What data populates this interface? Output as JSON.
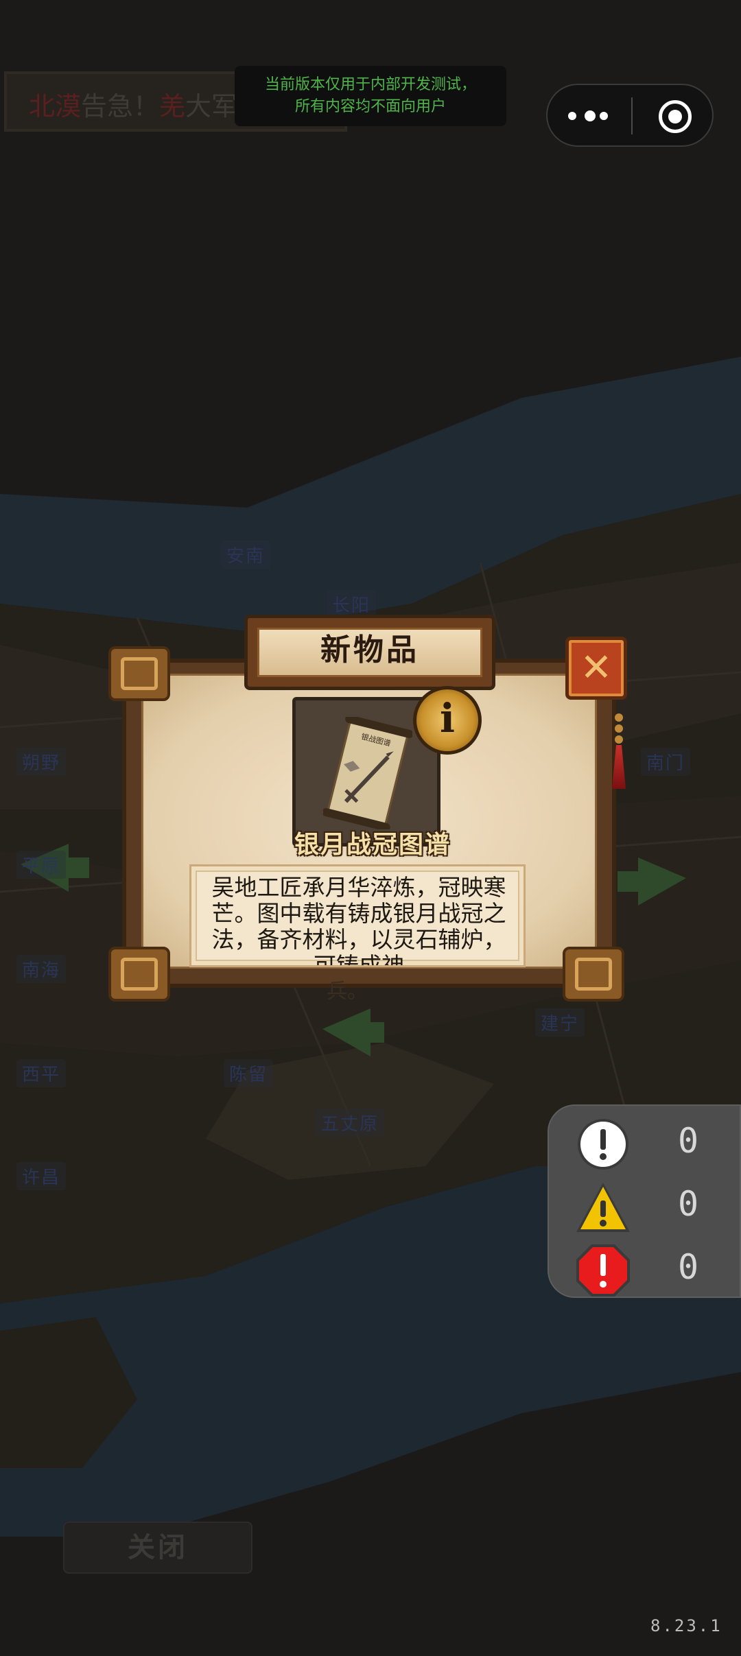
{
  "alert_banner": {
    "part1": "北漠",
    "part2": "告急！",
    "part3": "羌",
    "part4": "大军压境"
  },
  "dev_notice": {
    "line1": "当前版本仅用于内部开发测试，",
    "line2": "所有内容均不面向用户"
  },
  "capsule": {
    "more_icon": "more-dots-icon",
    "target_icon": "target-icon"
  },
  "map_labels": [
    "安南",
    "长阳",
    "朔野",
    "平原",
    "南海",
    "西平",
    "陈留",
    "五丈原",
    "许昌",
    "建宁",
    "南门"
  ],
  "modal": {
    "title": "新物品",
    "item_name": "银月战冠图谱",
    "scroll_caption": "银战图谱",
    "description": "吴地工匠承月华淬炼，冠映寒芒。图中载有铸成银月战冠之法，备齐材料，以灵石辅炉，可铸成神",
    "description_overflow": "兵。",
    "info_icon_glyph": "i",
    "close_icon_glyph": "✕"
  },
  "counters": [
    {
      "icon": "info-circle-icon",
      "value": "0",
      "color": "#ffffff"
    },
    {
      "icon": "warning-triangle-icon",
      "value": "0",
      "color": "#f2c300"
    },
    {
      "icon": "error-octagon-icon",
      "value": "0",
      "color": "#e81c1c"
    }
  ],
  "close_button": "关闭",
  "version": "8.23.1"
}
